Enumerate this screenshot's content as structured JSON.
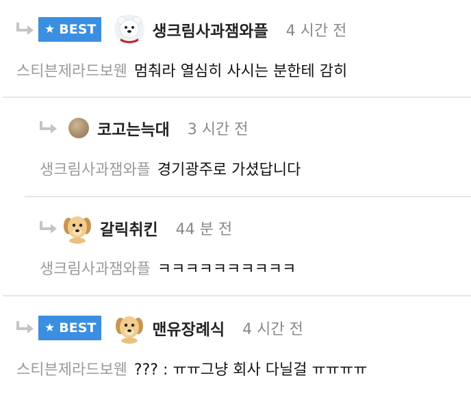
{
  "comments": [
    {
      "best_label": "BEST",
      "username": "생크림사과잼와플",
      "time": "4 시간 전",
      "mention": "스티븐제라드보웬",
      "text": "멈춰라 열심히 사시는 분한테 감히"
    },
    {
      "username": "코고는늑대",
      "time": "3 시간 전",
      "mention": "생크림사과잼와플",
      "text": "경기광주로 가셨답니다"
    },
    {
      "username": "갈릭취킨",
      "time": "44 분 전",
      "mention": "생크림사과잼와플",
      "text": "ㅋㅋㅋㅋㅋㅋㅋㅋㅋㅋ"
    },
    {
      "best_label": "BEST",
      "username": "맨유장례식",
      "time": "4 시간 전",
      "mention": "스티븐제라드보웬",
      "text": "??? : ㅠㅠ그냥 회사 다닐걸 ㅠㅠㅠㅠ"
    }
  ],
  "icons": {
    "reply": "reply-arrow-icon",
    "star": "star-icon"
  },
  "colors": {
    "best_badge": "#3a8fe0",
    "mention": "#9a9a9a",
    "time": "#888888",
    "divider": "#e6e6e6"
  }
}
